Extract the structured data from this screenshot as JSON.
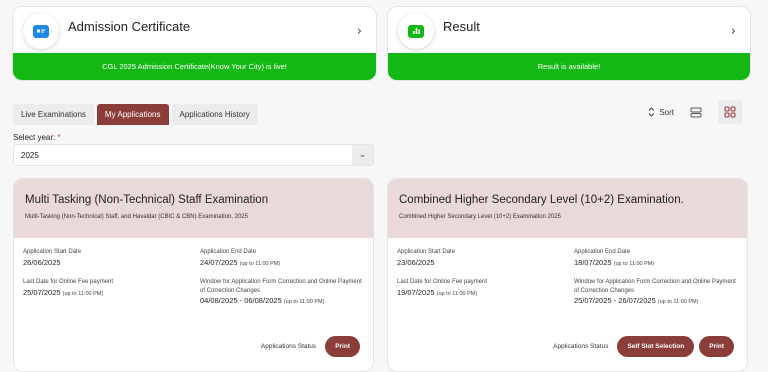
{
  "top_cards": [
    {
      "title": "Admission Certificate",
      "banner": "CGL 2025 Admission Certificate(Know Your City) is live!",
      "icon": "id-card-icon",
      "icon_color": "#1e88e5"
    },
    {
      "title": "Result",
      "banner": "Result is available!",
      "icon": "bar-chart-icon",
      "icon_color": "#14b814"
    }
  ],
  "tabs": [
    {
      "label": "Live Examinations",
      "active": false
    },
    {
      "label": "My Applications",
      "active": true
    },
    {
      "label": "Applications History",
      "active": false
    }
  ],
  "toolbar": {
    "sort_label": "Sort"
  },
  "year_select": {
    "label": "Select year:",
    "required_mark": "*",
    "value": "2025"
  },
  "applications": [
    {
      "title": "Multi Tasking (Non-Technical) Staff Examination",
      "subtitle": "Multi-Tasking (Non-Technical) Staff, and Havaldar (CBIC & CBN) Examination, 2025",
      "start_label": "Application Start Date",
      "start_value": "26/06/2025",
      "end_label": "Application End Date",
      "end_value": "24/07/2025",
      "end_note": "(up to 11:00 PM)",
      "fee_label": "Last Date for Online Fee payment",
      "fee_value": "25/07/2025",
      "fee_note": "(up to 11:00 PM)",
      "window_label": "Window for Application Form Correction and Online Payment of Correction Changes",
      "window_value": "04/08/2025 - 06/08/2025",
      "window_note": "(up to 11:00 PM)",
      "status_label": "Applications Status",
      "buttons": [
        "Print"
      ]
    },
    {
      "title": "Combined Higher Secondary Level (10+2) Examination.",
      "subtitle": "Combined Higher Secondary Level (10+2) Examination 2025",
      "start_label": "Application Start Date",
      "start_value": "23/06/2025",
      "end_label": "Application End Date",
      "end_value": "18/07/2025",
      "end_note": "(up to 11:00 PM)",
      "fee_label": "Last Date for Online Fee payment",
      "fee_value": "19/07/2025",
      "fee_note": "(up to 11:00 PM)",
      "window_label": "Window for Application Form Correction and Online Payment of Correction Changes",
      "window_value": "25/07/2025 - 26/07/2025",
      "window_note": "(up to 11:00 PM)",
      "status_label": "Applications Status",
      "buttons": [
        "Self Slot Selection",
        "Print"
      ]
    }
  ],
  "colors": {
    "accent": "#8a3d39",
    "banner_green": "#14b814",
    "card_header": "#ead9d9"
  }
}
